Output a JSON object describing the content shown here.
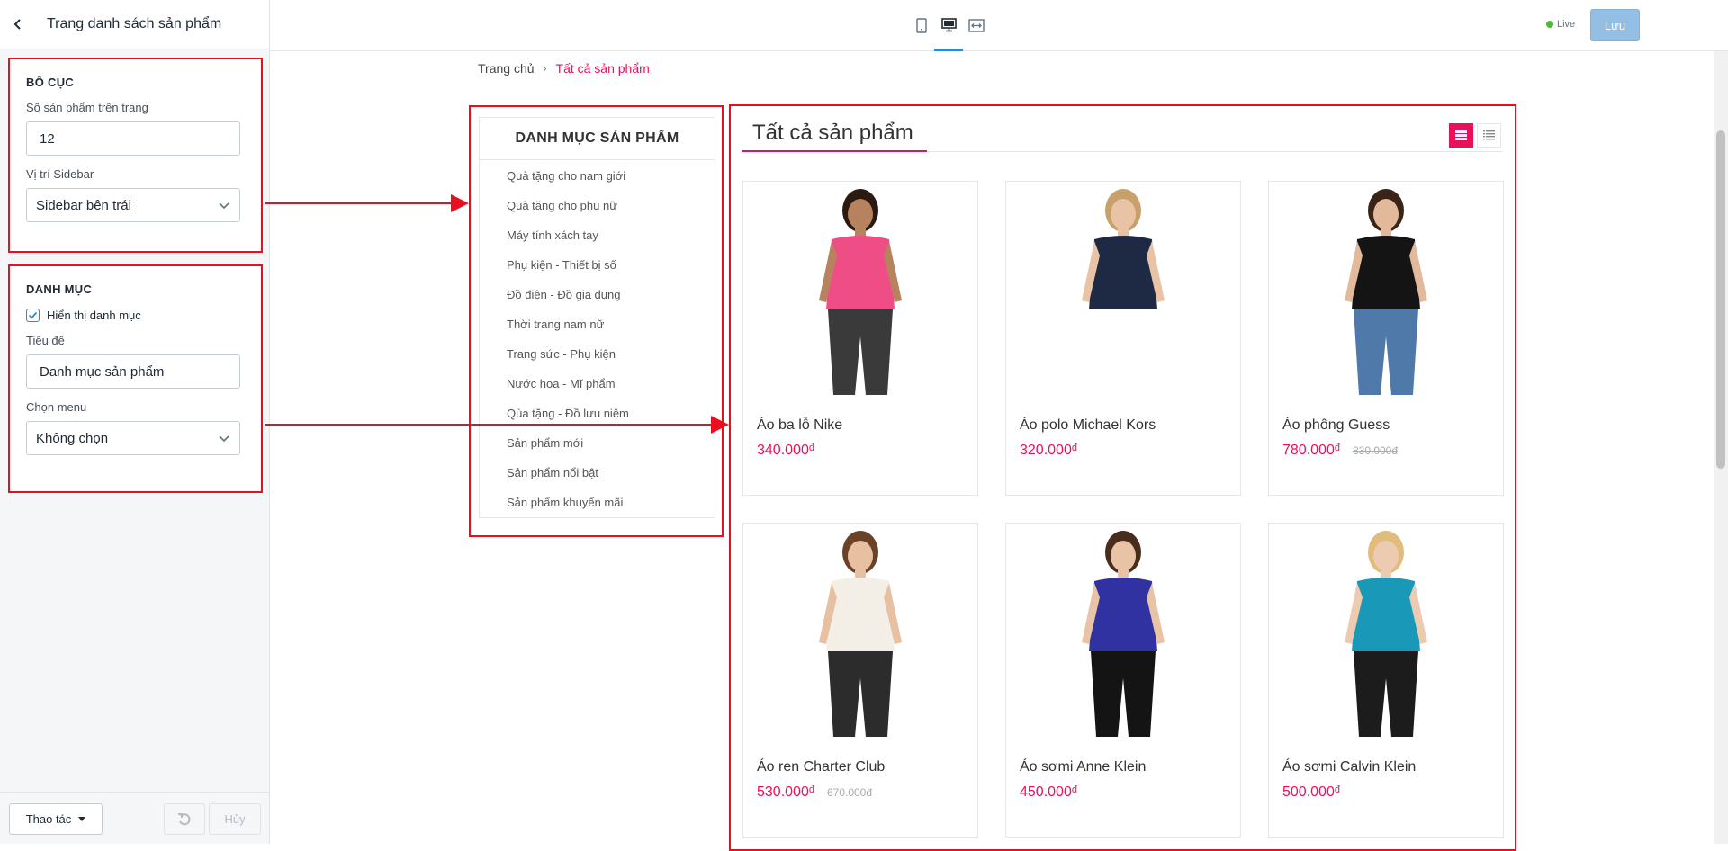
{
  "editor": {
    "title": "Trang danh sách sản phẩm",
    "layout_section": {
      "heading": "BỐ CỤC",
      "products_per_page_label": "Số sản phẩm trên trang",
      "products_per_page_value": "12",
      "sidebar_position_label": "Vị trí Sidebar",
      "sidebar_position_value": "Sidebar bên trái"
    },
    "category_section": {
      "heading": "DANH MỤC",
      "show_category_label": "Hiển thị danh mục",
      "show_category_checked": true,
      "title_label": "Tiêu đề",
      "title_value": "Danh mục sản phẩm",
      "menu_label": "Chọn menu",
      "menu_value": "Không chọn"
    },
    "footer": {
      "actions_label": "Thao tác",
      "cancel_label": "Hủy"
    }
  },
  "topbar": {
    "live_label": "Live",
    "save_label": "Lưu",
    "active_device": "desktop"
  },
  "preview": {
    "breadcrumb": {
      "home": "Trang chủ",
      "separator": "›",
      "current": "Tất cả sản phẩm"
    },
    "category_panel": {
      "title": "DANH MỤC SẢN PHẨM",
      "items": [
        "Quà tặng cho nam giới",
        "Quà tặng cho phụ nữ",
        "Máy tính xách tay",
        "Phụ kiện - Thiết bị số",
        "Đồ điện - Đồ gia dụng",
        "Thời trang nam nữ",
        "Trang sức - Phụ kiện",
        "Nước hoa - Mĩ phẩm",
        "Qùa tặng - Đồ lưu niệm",
        "Sản phẩm mới",
        "Sản phẩm nổi bật",
        "Sản phẩm khuyến mãi"
      ]
    },
    "products_heading": "Tất cả sản phẩm",
    "currency_symbol": "đ",
    "accent_color": "#e7105b",
    "products": [
      {
        "name": "Áo ba lỗ Nike",
        "price": "340.000",
        "old_price": ""
      },
      {
        "name": "Áo polo Michael Kors",
        "price": "320.000",
        "old_price": ""
      },
      {
        "name": "Áo phông Guess",
        "price": "780.000",
        "old_price": "830.000"
      },
      {
        "name": "Áo ren Charter Club",
        "price": "530.000",
        "old_price": "670.000"
      },
      {
        "name": "Áo sơmi Anne Klein",
        "price": "450.000",
        "old_price": ""
      },
      {
        "name": "Áo sơmi Calvin Klein",
        "price": "500.000",
        "old_price": ""
      }
    ]
  }
}
